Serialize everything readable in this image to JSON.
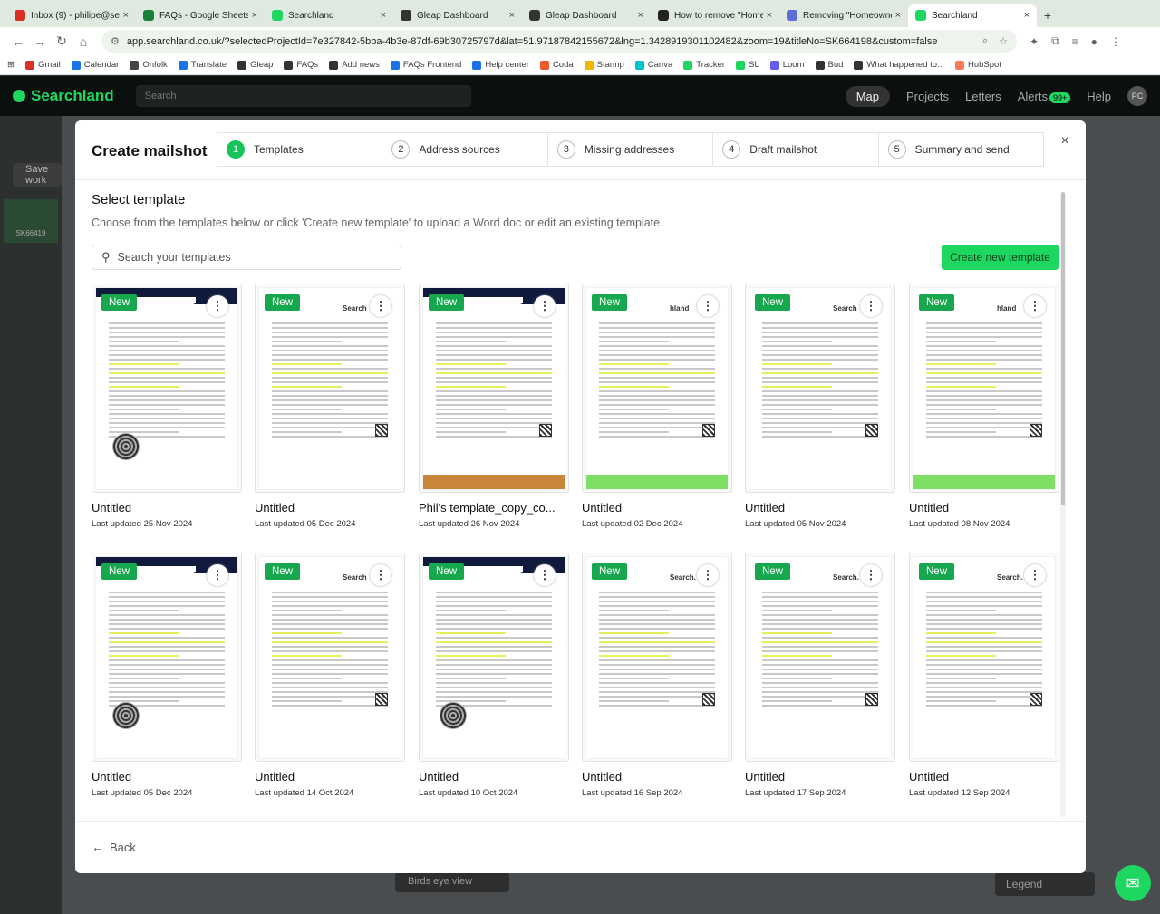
{
  "browser": {
    "tabs": [
      {
        "title": "Inbox (9) - philipe@se",
        "color": "#d93025",
        "active": false
      },
      {
        "title": "FAQs - Google Sheets",
        "color": "#188038",
        "active": false
      },
      {
        "title": "Searchland",
        "color": "#1ed760",
        "active": false
      },
      {
        "title": "Gleap Dashboard",
        "color": "#333333",
        "active": false
      },
      {
        "title": "Gleap Dashboard",
        "color": "#333333",
        "active": false
      },
      {
        "title": "How to remove \"Home",
        "color": "#222222",
        "active": false
      },
      {
        "title": "Removing \"Homeowne",
        "color": "#5b6fd6",
        "active": false
      },
      {
        "title": "Searchland",
        "color": "#1ed760",
        "active": true
      }
    ],
    "new_tab": "+",
    "url": "app.searchland.co.uk/?selectedProjectId=7e327842-5bba-4b3e-87df-69b30725797d&lat=51.97187842155672&lng=1.3428919301102482&zoom=19&titleNo=SK664198&custom=false",
    "bookmarks": [
      {
        "label": "Gmail",
        "color": "#d93025"
      },
      {
        "label": "Calendar",
        "color": "#1a73e8"
      },
      {
        "label": "Onfolk",
        "color": "#444444"
      },
      {
        "label": "Translate",
        "color": "#1a73e8"
      },
      {
        "label": "Gleap",
        "color": "#333333"
      },
      {
        "label": "FAQs",
        "color": "#333333"
      },
      {
        "label": "Add news",
        "color": "#333333"
      },
      {
        "label": "FAQs Frontend",
        "color": "#1a73e8"
      },
      {
        "label": "Help center",
        "color": "#1a73e8"
      },
      {
        "label": "Coda",
        "color": "#ee5a29"
      },
      {
        "label": "Stannp",
        "color": "#f2b705"
      },
      {
        "label": "Canva",
        "color": "#00c4cc"
      },
      {
        "label": "Tracker",
        "color": "#1ed760"
      },
      {
        "label": "SL",
        "color": "#1ed760"
      },
      {
        "label": "Loom",
        "color": "#625df5"
      },
      {
        "label": "Bud",
        "color": "#333333"
      },
      {
        "label": "What happened to...",
        "color": "#333333"
      },
      {
        "label": "HubSpot",
        "color": "#ff7a59"
      }
    ]
  },
  "app": {
    "brand": "Searchland",
    "search_placeholder": "Search",
    "nav": {
      "map": "Map",
      "projects": "Projects",
      "letters": "Letters",
      "alerts": "Alerts",
      "alerts_count": "99+",
      "help": "Help",
      "avatar": "PC"
    },
    "save_work": "Save work",
    "parcel_id": "SK66419",
    "birds_eye": "Birds eye view",
    "legend": "Legend"
  },
  "modal": {
    "title": "Create mailshot",
    "steps": [
      {
        "num": "1",
        "label": "Templates",
        "active": true
      },
      {
        "num": "2",
        "label": "Address sources",
        "active": false
      },
      {
        "num": "3",
        "label": "Missing addresses",
        "active": false
      },
      {
        "num": "4",
        "label": "Draft mailshot",
        "active": false
      },
      {
        "num": "5",
        "label": "Summary and send",
        "active": false
      }
    ],
    "close": "×",
    "section_title": "Select template",
    "section_sub": "Choose from the templates below or click 'Create new template' to upload a Word doc or edit an existing template.",
    "search_placeholder": "Search your templates",
    "create_button": "Create new template",
    "back": "Back",
    "new_badge": "New",
    "templates": [
      {
        "name": "Untitled",
        "updated": "Last updated 25 Nov 2024",
        "style": "navy",
        "logo": ""
      },
      {
        "name": "Untitled",
        "updated": "Last updated 05 Dec 2024",
        "style": "search",
        "logo": "Search"
      },
      {
        "name": "Phil's template_copy_co...",
        "updated": "Last updated 26 Nov 2024",
        "style": "orange",
        "logo": ""
      },
      {
        "name": "Untitled",
        "updated": "Last updated 02 Dec 2024",
        "style": "green",
        "logo": "hland"
      },
      {
        "name": "Untitled",
        "updated": "Last updated 05 Nov 2024",
        "style": "search",
        "logo": "Search"
      },
      {
        "name": "Untitled",
        "updated": "Last updated 08 Nov 2024",
        "style": "green",
        "logo": "hland"
      },
      {
        "name": "Untitled",
        "updated": "Last updated 05 Dec 2024",
        "style": "navy",
        "logo": ""
      },
      {
        "name": "Untitled",
        "updated": "Last updated 14 Oct 2024",
        "style": "search",
        "logo": "Search"
      },
      {
        "name": "Untitled",
        "updated": "Last updated 10 Oct 2024",
        "style": "navy",
        "logo": ""
      },
      {
        "name": "Untitled",
        "updated": "Last updated 16 Sep 2024",
        "style": "search",
        "logo": "Search."
      },
      {
        "name": "Untitled",
        "updated": "Last updated 17 Sep 2024",
        "style": "search",
        "logo": "Search."
      },
      {
        "name": "Untitled",
        "updated": "Last updated 12 Sep 2024",
        "style": "search",
        "logo": "Search."
      }
    ]
  },
  "colors": {
    "accent": "#1ed760",
    "badge": "#17a84f",
    "orange_band": "#c9863a",
    "green_band": "#7ddf64"
  }
}
